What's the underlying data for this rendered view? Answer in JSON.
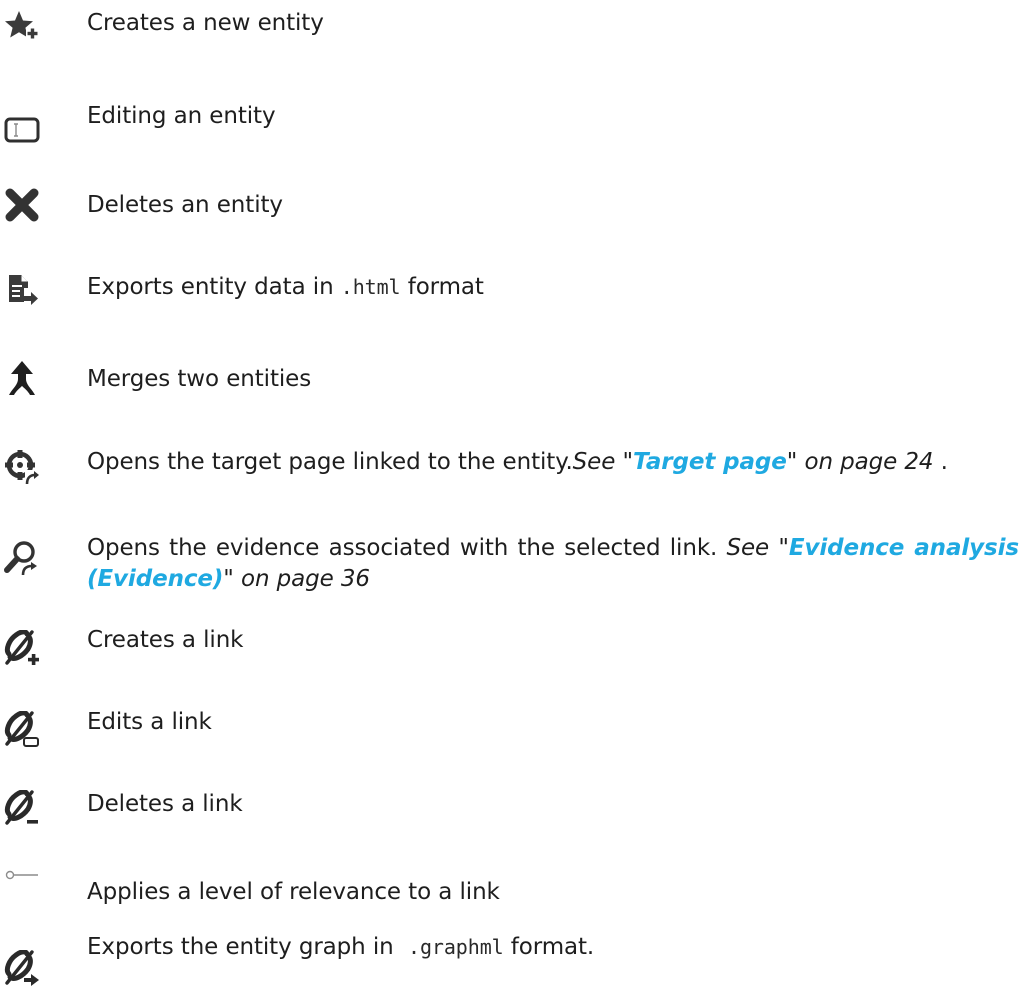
{
  "rows": [
    {
      "icon": "star-plus-icon",
      "text": "Creates a new entity"
    },
    {
      "icon": "text-field-icon",
      "text": "Editing an entity"
    },
    {
      "icon": "close-x-icon",
      "text": "Deletes an entity"
    },
    {
      "icon": "document-export-icon",
      "text_before": "Exports entity data in ",
      "code": ".html",
      "text_after": " format"
    },
    {
      "icon": "merge-arrow-icon",
      "text": "Merges two entities"
    },
    {
      "icon": "target-crosshair-icon",
      "text": "Opens the target page linked to the entity.",
      "ref_pre": "See \"",
      "ref_link": "Target page",
      "ref_post": "\" on page 24",
      "tail": " ."
    },
    {
      "icon": "magnifier-arrow-icon",
      "text": "Opens the evidence associated with the selected link. ",
      "ref_pre": "See \"",
      "ref_link": "Evidence analysis (Evidence)",
      "ref_post": "\" on page 36"
    },
    {
      "icon": "link-plus-icon",
      "text": "Creates a link"
    },
    {
      "icon": "link-edit-icon",
      "text": "Edits a link"
    },
    {
      "icon": "link-minus-icon",
      "text": "Deletes a link"
    },
    {
      "icon": "relevance-slider-icon",
      "text": "Applies a level of relevance to a link"
    },
    {
      "icon": "link-export-icon",
      "text_before": "Exports the entity graph in  ",
      "code": ".graphml",
      "text_after": " format."
    }
  ]
}
